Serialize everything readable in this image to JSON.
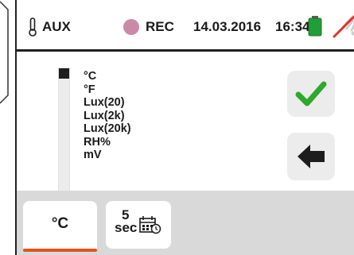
{
  "status_bar": {
    "mode": "AUX",
    "rec": "REC",
    "date": "14.03.2016",
    "time": "16:34",
    "icons": [
      "thermometer-probe-icon",
      "record-dot-icon",
      "battery-icon",
      "wireless-off-icon"
    ],
    "colors": {
      "rec_dot": "#c88aa7",
      "battery": "#1f9e3a",
      "wireless_off": "#e0302a"
    }
  },
  "unit_selector": {
    "options": [
      "°C",
      "°F",
      "Lux(20)",
      "Lux(2k)",
      "Lux(20k)",
      "RH%",
      "mV"
    ],
    "selected": "°C"
  },
  "actions": {
    "confirm_icon": "check-icon",
    "back_icon": "back-arrow-icon",
    "colors": {
      "confirm": "#2fa82c",
      "back": "#1d1d1d"
    }
  },
  "tabs": {
    "unit_tab": "°C",
    "interval_value": "5",
    "interval_unit": "sec",
    "interval_icon": "calendar-clock-icon",
    "colors": {
      "active_underline": "#e8521d",
      "bar": "#d9d9d9"
    }
  }
}
